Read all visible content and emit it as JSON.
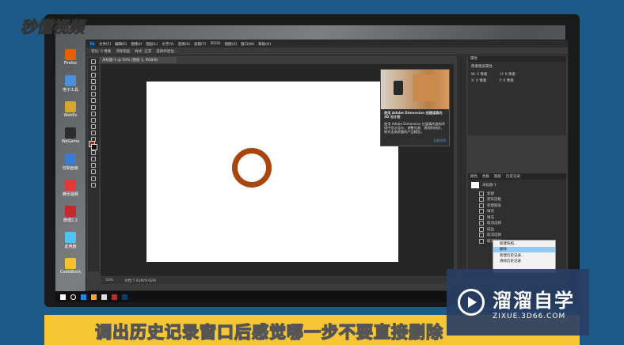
{
  "overlay": {
    "watermark_text": "秒懂视频",
    "caption": "调出历史记录窗口后感觉哪一步不要直接删除",
    "brand_title": "溜溜自学",
    "brand_url": "ZIXUE.3D66.COM"
  },
  "desktop": {
    "icons": [
      {
        "label": "Firefox",
        "color": "#e66000"
      },
      {
        "label": "电子工具",
        "color": "#4a90d9"
      },
      {
        "label": "WebEx",
        "color": "#d6a72b"
      },
      {
        "label": "WeGame",
        "color": "#2c2c2c"
      },
      {
        "label": "控制面板",
        "color": "#3a7bd5"
      },
      {
        "label": "腾讯视频",
        "color": "#e53935"
      },
      {
        "label": "微博2.2",
        "color": "#c62828"
      },
      {
        "label": "此电脑",
        "color": "#4fc3f7"
      },
      {
        "label": "CodeBlock",
        "color": "#fbc02d"
      }
    ]
  },
  "photoshop": {
    "app_icon": "Ps",
    "menu": [
      "文件(F)",
      "编辑(E)",
      "图像(I)",
      "图层(L)",
      "文字(Y)",
      "选择(S)",
      "滤镜(T)",
      "3D(D)",
      "视图(V)",
      "窗口(W)",
      "帮助(H)"
    ],
    "options": [
      "羽化: 0 像素",
      "消除锯齿",
      "样式: 正常",
      "选择并遮住..."
    ],
    "doc_tab": "未标题-1 @ 50% (图层 1, RGB/8)",
    "status": {
      "zoom": "50%",
      "doc_size": "文档:7.91M/9.92M"
    },
    "popup": {
      "title": "使用 Adobe Dimension 创建逼真的 3D 设计图",
      "body": "使用 Adobe Dimension 在逼真的虚拟环境中显示设计。调整光源、透视和材质，制作出高质量的产品模型。",
      "link": "立即试用"
    },
    "properties": {
      "header": "属性",
      "subheader": "像素图层属性",
      "fields": [
        {
          "label": "W: 0 像素",
          "value": "H: 0 像素"
        },
        {
          "label": "X: 0 像素",
          "value": "Y: 0 像素"
        }
      ]
    },
    "history": {
      "tabs": [
        "颜色",
        "色板",
        "图层",
        "历史记录"
      ],
      "snapshot": "未标题-1",
      "items": [
        "新建",
        "矩形选框",
        "新建图层",
        "填充",
        "填充",
        "取消选择",
        "描边",
        "取消选择",
        "取消选择"
      ]
    },
    "context_menu": {
      "items": [
        "新建快照...",
        "删除",
        "新建历史记录...",
        "清除历史记录"
      ],
      "selected_index": 1
    }
  }
}
